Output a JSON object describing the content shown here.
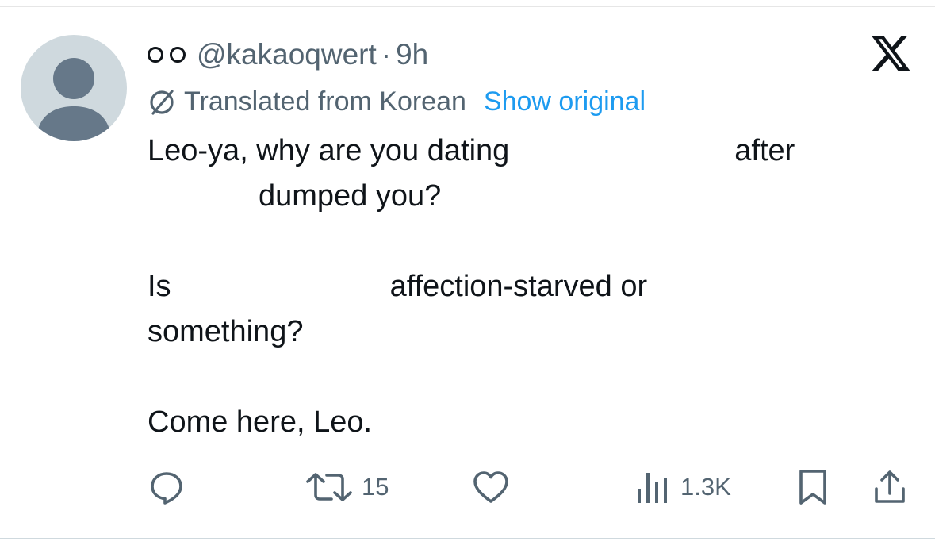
{
  "tweet": {
    "display_name_glyphs": [
      "circle",
      "circle"
    ],
    "handle": "@kakaoqwert",
    "separator": "·",
    "time": "9h",
    "translation": {
      "label": "Translated from Korean",
      "show_original": "Show original"
    },
    "text": {
      "line1": "Leo-ya, why are you dating",
      "line1_end": "after",
      "line2": "dumped you?",
      "line3_start": "Is",
      "line3_end": "affection-starved or",
      "line4": "something?",
      "line5": "Come here, Leo."
    }
  },
  "actions": {
    "reply": {
      "icon": "reply-icon",
      "count": ""
    },
    "retweet": {
      "icon": "retweet-icon",
      "count": "15"
    },
    "like": {
      "icon": "heart-icon",
      "count": ""
    },
    "views": {
      "icon": "views-icon",
      "count": "1.3K"
    },
    "bookmark": {
      "icon": "bookmark-icon"
    },
    "share": {
      "icon": "share-icon"
    }
  },
  "icons": {
    "close": "x-logo-icon",
    "translate": "globe-slash-icon"
  },
  "colors": {
    "text": "#0f1419",
    "secondary": "#536471",
    "link": "#1d9bf0",
    "avatar_bg": "#cfd9de",
    "avatar_figure": "#667889"
  }
}
